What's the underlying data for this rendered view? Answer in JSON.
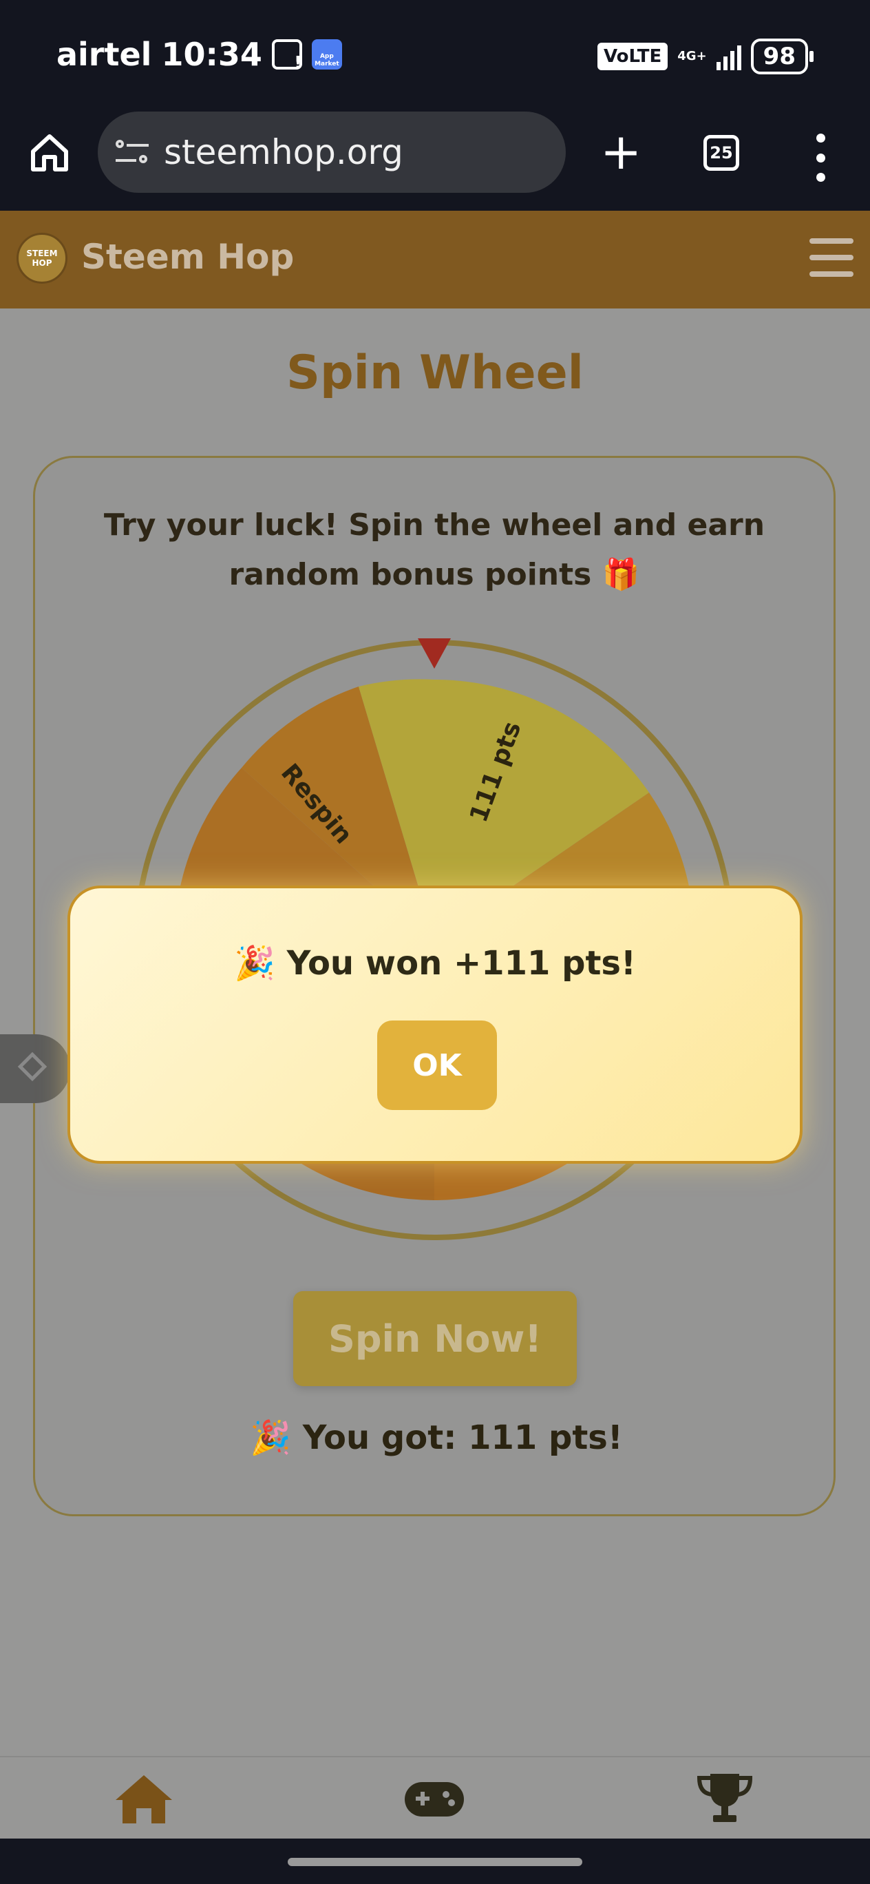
{
  "status_bar": {
    "carrier": "airtel",
    "time": "10:34",
    "volte": "VoLTE",
    "network": "4G+",
    "battery": "98",
    "app_badge": "App Market"
  },
  "browser": {
    "url": "steemhop.org",
    "tab_count": "25",
    "new_tab_label": "+"
  },
  "header": {
    "brand": "Steem Hop",
    "logo_text": "STEEM HOP"
  },
  "page": {
    "title": "Spin Wheel",
    "description": "Try your luck! Spin the wheel and earn random bonus points 🎁",
    "spin_button": "Spin Now!",
    "result": "🎉 You got: 111 pts!"
  },
  "wheel": {
    "labels": [
      "Respin",
      "111 pts"
    ],
    "colors": {
      "orange": "#b47221",
      "yellow": "#b3a53a",
      "rim": "#8e7a38"
    }
  },
  "modal": {
    "message": "🎉 You won +111 pts!",
    "ok_label": "OK"
  },
  "bottom_nav": {
    "items": [
      "home-icon",
      "gamepad-icon",
      "trophy-icon"
    ]
  },
  "colors": {
    "accent": "#e2b23c",
    "brand_brown": "#805920"
  }
}
